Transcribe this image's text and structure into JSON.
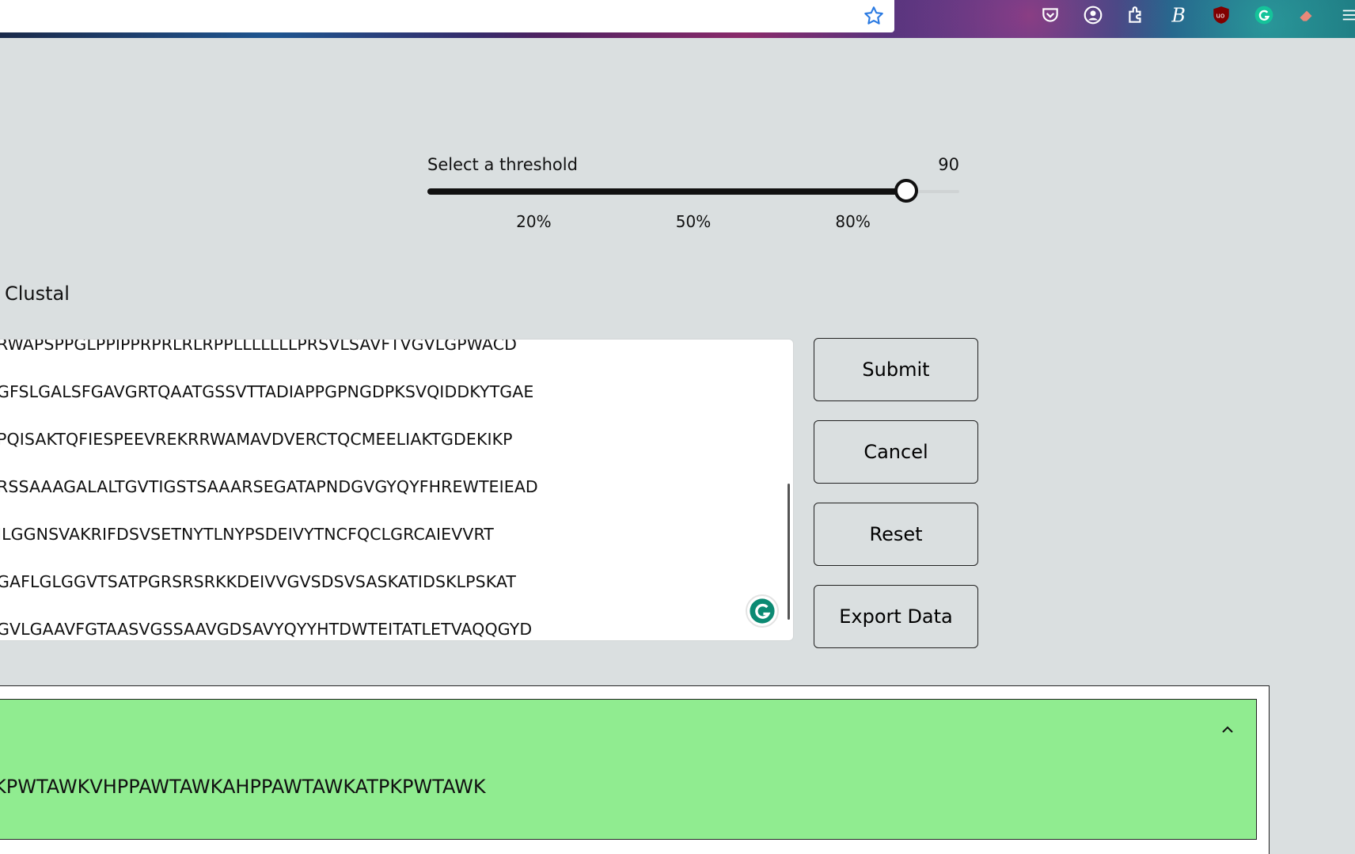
{
  "browser": {
    "toolbar_icons": [
      "pocket-icon",
      "account-icon",
      "extensions-icon",
      "b-extension-icon",
      "ublock-icon",
      "grammarly-icon",
      "eraser-icon",
      "menu-icon"
    ]
  },
  "slider": {
    "label": "Select a threshold",
    "value": "90",
    "value_number": 90,
    "marks": [
      "20%",
      "50%",
      "80%"
    ]
  },
  "section": {
    "title": "Clustal"
  },
  "sequences": [
    "RWAPSPPGLPPIPPRPRLRLRPPLLLLLLLPRSVLSAVFTVGVLGPWACD",
    "GFSLGALSFGAVGRTQAATGSSVTTADIAPPGPNGDPKSVQIDDKYTGAE",
    "PQISAKTQFIESPEEVREKRRWAMAVDVERCTQCMEELIAKTGDEKIKP",
    "RSSAAAGALALTGVTIGSTSAAARSEGATAPNDGVGYQYFHREWTEIEAD",
    "ILGGNSVAKRIFDSVSETNYTLNYPSDEIVYTNCFQCLGRCAIEVVRT",
    "GAFLGLGGVTSATPGRSRSRKKDEIVVGVSDSVSASKATIDSKLPSKAT",
    "GVLGAAVFGTAASVGSSAAVGDSAVYQYYHTDWTEITATLETVAQQGYD"
  ],
  "buttons": {
    "submit": "Submit",
    "cancel": "Cancel",
    "reset": "Reset",
    "export": "Export Data"
  },
  "result": {
    "sequence": "KPWTAWKVHPPAWTAWKAHPPAWTAWKATPKPWTAWK"
  }
}
